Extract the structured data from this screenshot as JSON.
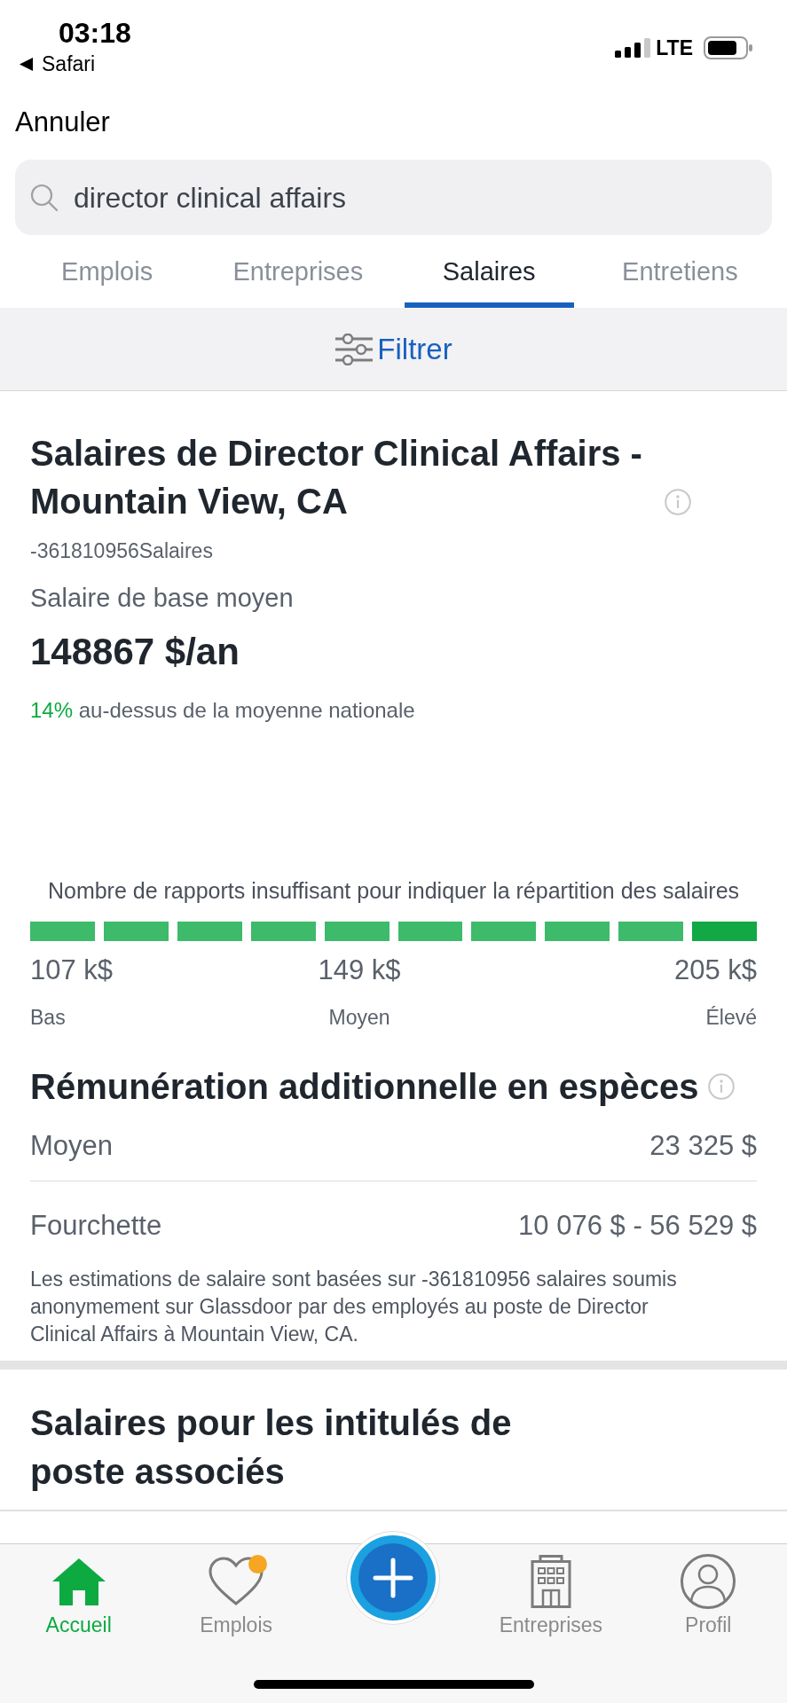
{
  "status_bar": {
    "time": "03:18",
    "back_app": "Safari",
    "network": "LTE"
  },
  "cancel": "Annuler",
  "search": {
    "value": "director clinical affairs"
  },
  "tabs": [
    {
      "label": "Emplois",
      "selected": false
    },
    {
      "label": "Entreprises",
      "selected": false
    },
    {
      "label": "Salaires",
      "selected": true
    },
    {
      "label": "Entretiens",
      "selected": false
    }
  ],
  "filter": {
    "label": "Filtrer"
  },
  "salary": {
    "title": "Salaires de Director Clinical Affairs - Mountain View, CA",
    "count": "-361810956Salaires",
    "base_label": "Salaire de base moyen",
    "base_value": "148867 $/an",
    "comparison": {
      "percent": "14%",
      "text": "au-dessus de la moyenne nationale"
    }
  },
  "distribution": {
    "note": "Nombre de rapports insuffisant pour indiquer la répartition des salaires",
    "segments": [
      {
        "highlighted": false
      },
      {
        "highlighted": false
      },
      {
        "highlighted": false
      },
      {
        "highlighted": false
      },
      {
        "highlighted": false
      },
      {
        "highlighted": false
      },
      {
        "highlighted": false
      },
      {
        "highlighted": false
      },
      {
        "highlighted": false
      },
      {
        "highlighted": true
      }
    ],
    "values": [
      "107 k$",
      "149 k$",
      "205 k$"
    ],
    "labels": [
      "Bas",
      "Moyen",
      "Élevé"
    ]
  },
  "additional_cash": {
    "title": "Rémunération additionnelle en espèces",
    "rows": [
      {
        "label": "Moyen",
        "value": "23 325 $"
      },
      {
        "label": "Fourchette",
        "value": "10 076 $ - 56 529 $"
      }
    ],
    "note": "Les estimations de salaire sont basées sur -361810956 salaires soumis anonymement sur Glassdoor par des employés au poste de Director Clinical Affairs à Mountain View, CA."
  },
  "related": {
    "title": "Salaires pour les intitulés de poste associés"
  },
  "tab_bar": [
    {
      "kind": "home",
      "label": "Accueil",
      "selected": true,
      "badge": false
    },
    {
      "kind": "heart",
      "label": "Emplois",
      "selected": false,
      "badge": true
    },
    {
      "kind": "building",
      "label": "Entreprises",
      "selected": false,
      "badge": false
    },
    {
      "kind": "person",
      "label": "Profil",
      "selected": false,
      "badge": false
    }
  ]
}
